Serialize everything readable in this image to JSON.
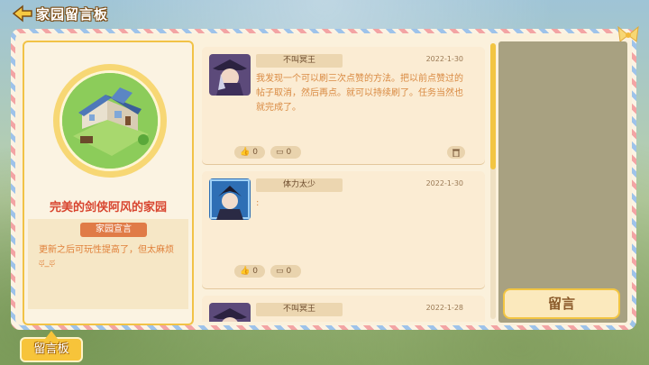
{
  "header": {
    "title": "家园留言板"
  },
  "owner": {
    "name": "完美的剑侠阿风",
    "suffix": "的家园"
  },
  "declaration": {
    "heading": "家园宣言",
    "text": "更新之后可玩性提高了，但太麻烦ಥ_ಥ"
  },
  "messages": [
    {
      "author": "不叫冥王",
      "date": "2022-1-30",
      "text": "我发现一个可以刷三次点赞的方法。把以前点赞过的帖子取消，然后再点。就可以持续刷了。任务当然也就完成了。",
      "likes": "0",
      "comments": "0",
      "has_trash": true
    },
    {
      "author": "体力太少",
      "date": "2022-1-30",
      "text": ":",
      "likes": "0",
      "comments": "0",
      "has_trash": false
    },
    {
      "author": "不叫冥王",
      "date": "2022-1-28",
      "text": "",
      "likes": "",
      "comments": "",
      "has_trash": false
    }
  ],
  "actions": {
    "leave_message": "留言"
  },
  "bottom_tab": {
    "label": "留言板"
  },
  "colors": {
    "accent": "#f2c542",
    "owner_name": "#d8452f",
    "text_orange": "#d98a42"
  }
}
